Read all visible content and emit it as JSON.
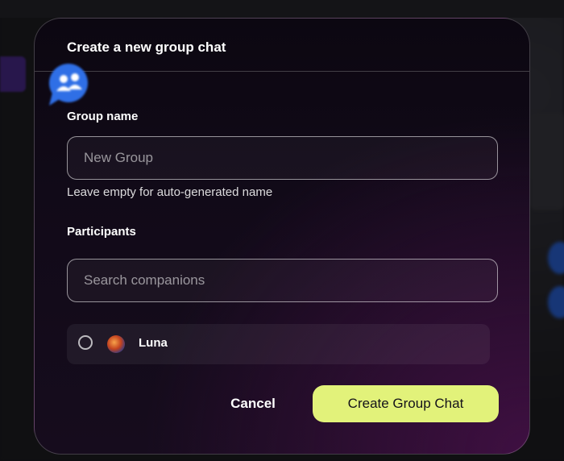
{
  "dialog": {
    "title": "Create a new group chat",
    "group_name": {
      "label": "Group name",
      "placeholder": "New Group",
      "value": "",
      "help": "Leave empty for auto-generated name"
    },
    "participants": {
      "label": "Participants",
      "search_placeholder": "Search companions",
      "search_value": "",
      "items": [
        {
          "name": "Luna",
          "selected": false
        }
      ]
    },
    "actions": {
      "cancel_label": "Cancel",
      "create_label": "Create Group Chat"
    }
  },
  "colors": {
    "primary_button": "#e2f27a",
    "dialog_background": "#110a18",
    "group_badge": "#2f6fe6"
  },
  "icons": {
    "group_badge": "group-chat-icon",
    "participant_avatar": "luna-avatar"
  }
}
